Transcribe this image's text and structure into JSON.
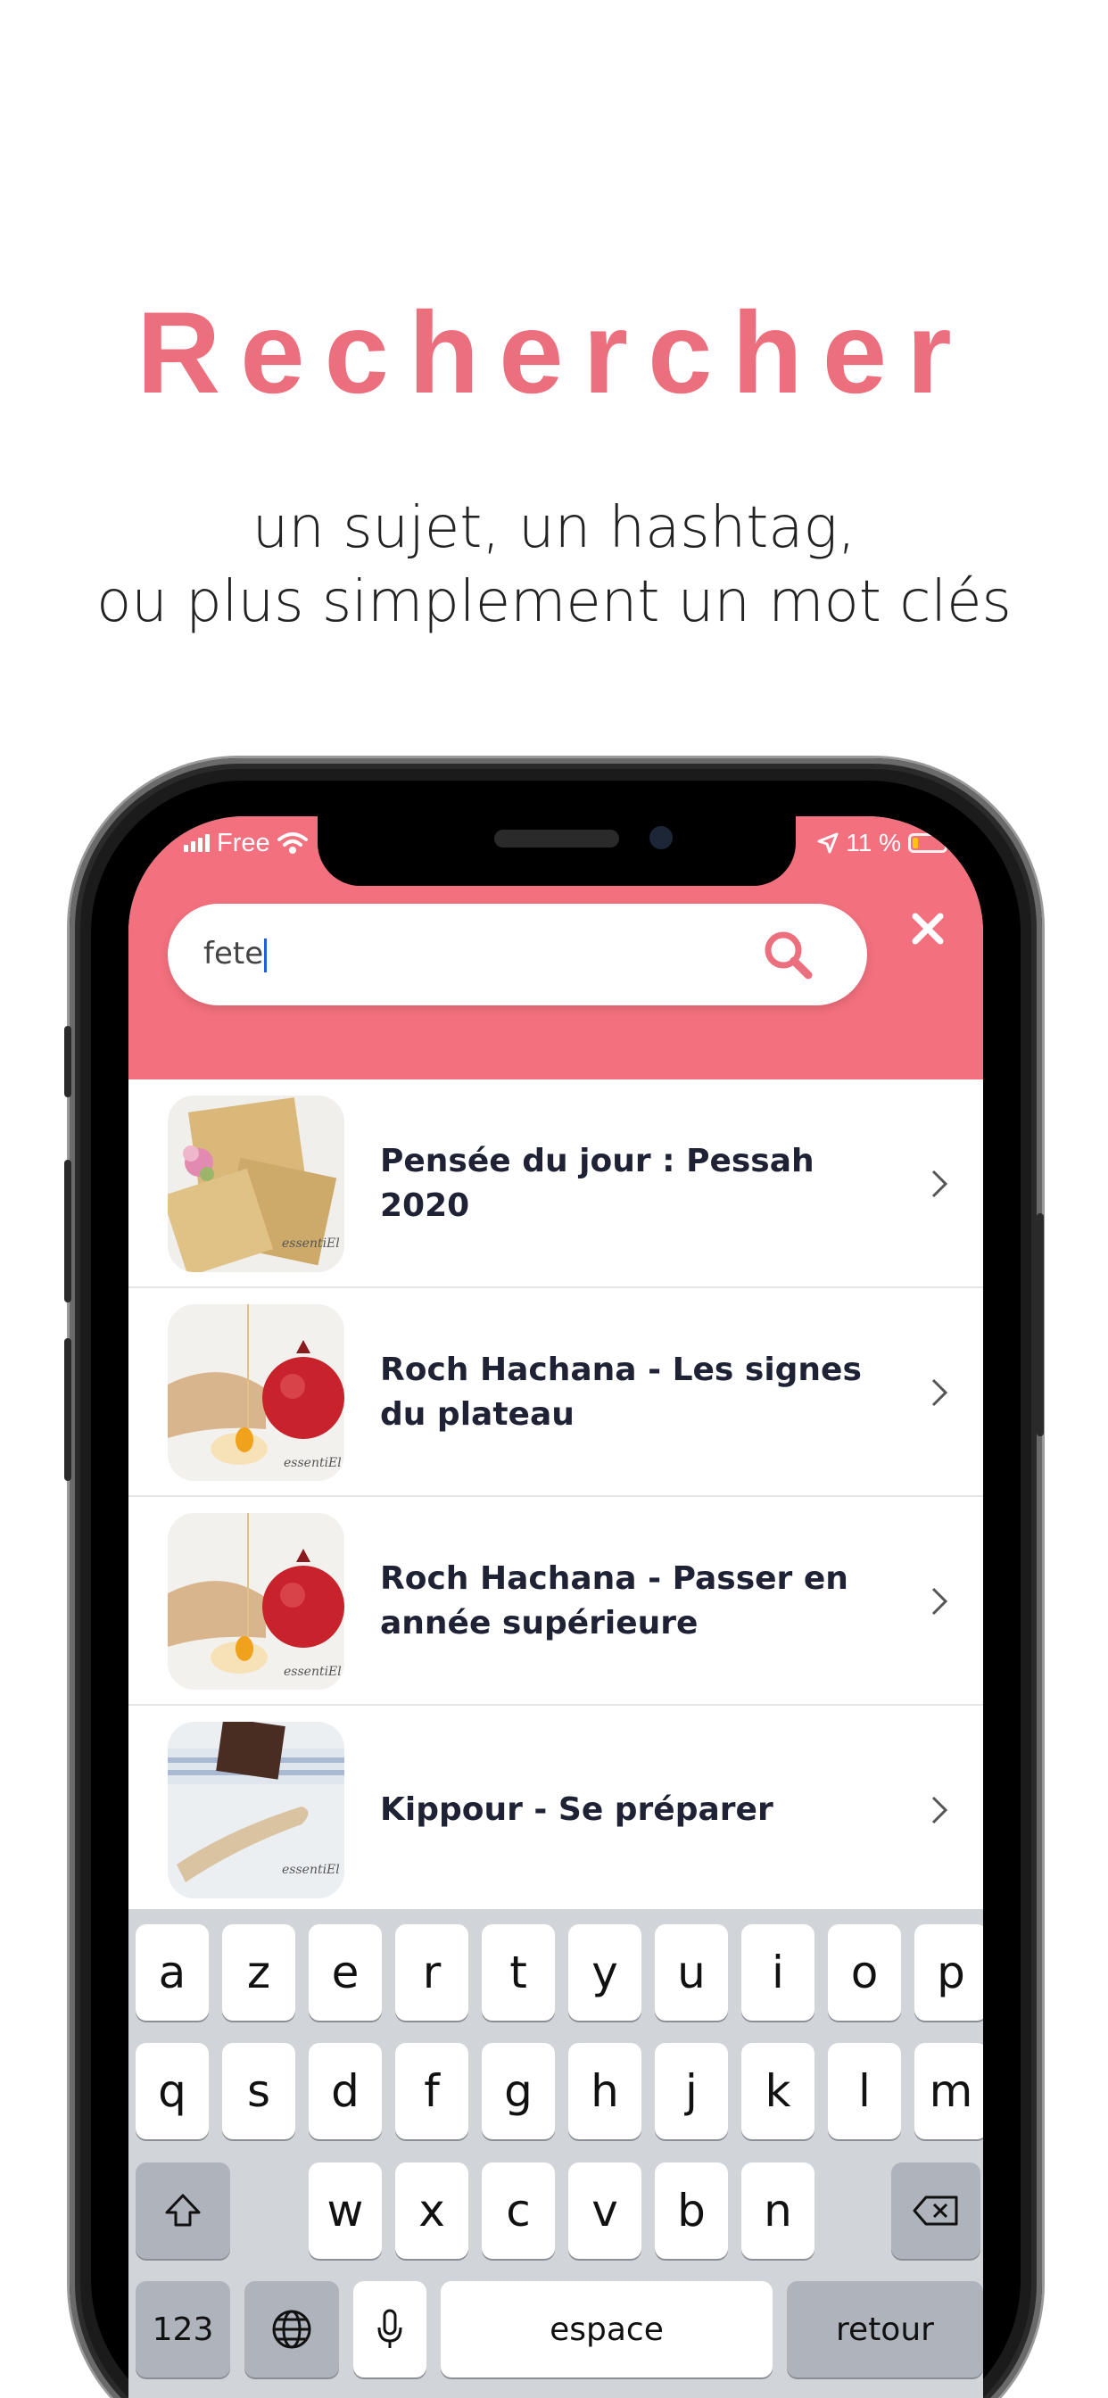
{
  "promo": {
    "title": "Rechercher",
    "subtitle_line1": "un sujet, un hashtag,",
    "subtitle_line2": "ou plus simplement un mot clés"
  },
  "status_bar": {
    "carrier": "Free",
    "battery_percent": "11 %"
  },
  "search": {
    "value": "fete"
  },
  "results": [
    {
      "title": "Pensée du jour : Pessah 2020",
      "thumb": "matzah"
    },
    {
      "title": "Roch Hachana - Les signes du plateau",
      "thumb": "pomegranate-honey"
    },
    {
      "title": "Roch Hachana - Passer en année supérieure",
      "thumb": "pomegranate-honey"
    },
    {
      "title": "Kippour - Se préparer",
      "thumb": "shofar"
    }
  ],
  "thumb_watermark": "essentiEl",
  "keyboard": {
    "row1": [
      "a",
      "z",
      "e",
      "r",
      "t",
      "y",
      "u",
      "i",
      "o",
      "p"
    ],
    "row2": [
      "q",
      "s",
      "d",
      "f",
      "g",
      "h",
      "j",
      "k",
      "l",
      "m"
    ],
    "row3": [
      "w",
      "x",
      "c",
      "v",
      "b",
      "n"
    ],
    "numbers_key": "123",
    "space_key": "espace",
    "return_key": "retour"
  },
  "colors": {
    "accent": "#ec6f7e",
    "header": "#f3707e",
    "keyboard_bg": "#d1d4d9"
  }
}
